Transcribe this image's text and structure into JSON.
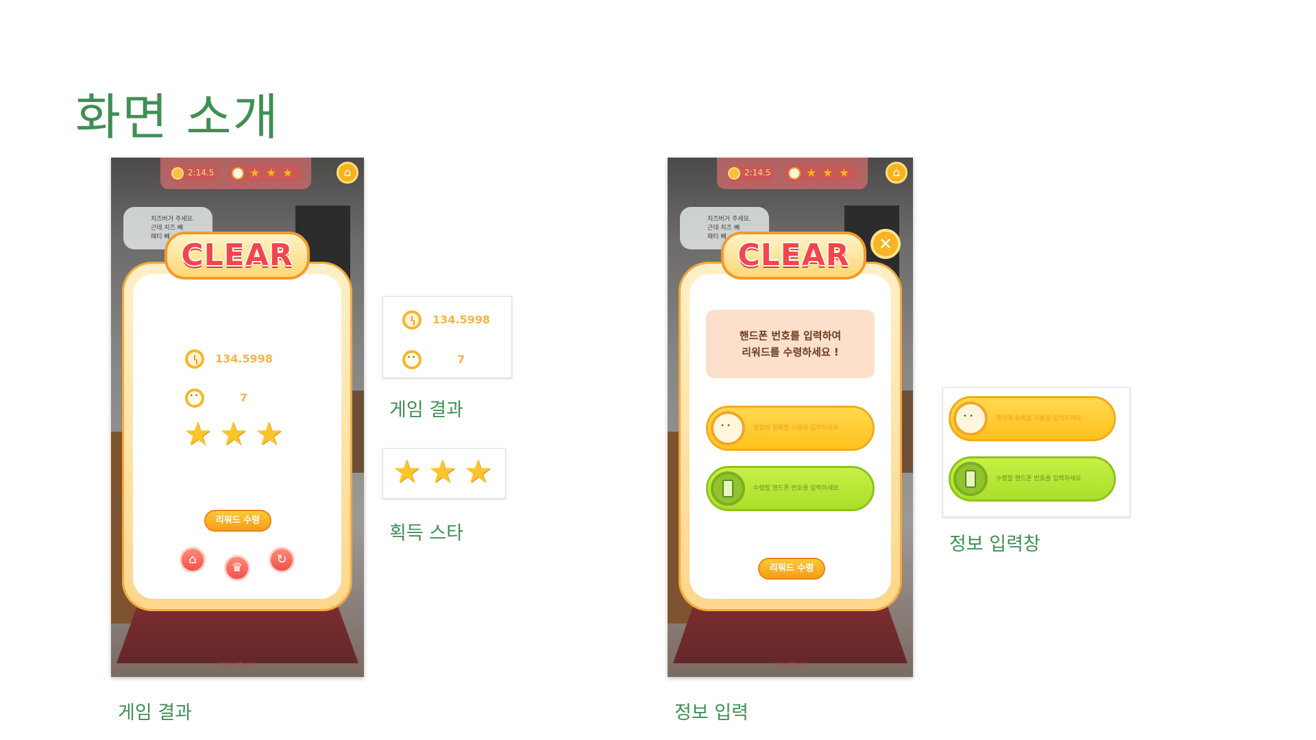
{
  "page": {
    "title": "화면 소개",
    "accent_color": "#3f8f54"
  },
  "captions": {
    "left_phone": "게임 결과",
    "right_phone": "정보 입력",
    "result_thumb": "게임 결과",
    "stars_thumb": "획득 스타",
    "input_thumb": "정보 입력창"
  },
  "hud": {
    "time": "2:14.5",
    "stars": 3,
    "icons": [
      "clock-icon",
      "character-face-icon",
      "star-icon",
      "home-icon"
    ]
  },
  "scene": {
    "sign_lines": [
      "치즈버거 주세요.",
      "근데 치즈 빼",
      "패티 빼"
    ]
  },
  "result_screen": {
    "banner": "CLEAR",
    "time_value": "134.5998",
    "star_count": "7",
    "stars_earned": 3,
    "reward_button": "리워드 수령",
    "bottom_buttons": [
      "home-icon",
      "trophy-icon",
      "replay-icon"
    ],
    "footer_text": "다음 게임 실!"
  },
  "input_screen": {
    "banner": "CLEAR",
    "notice_line1": "핸드폰 번호를 입력하여",
    "notice_line2": "리워드를 수령하세요 !",
    "name_placeholder": "랭킹에 등록할 이름을 입력하세요",
    "phone_placeholder": "수령할 핸드폰 번호를 입력하세요",
    "reward_button": "리워드 수령",
    "footer_text": "다음 게임 실!"
  },
  "thumbnails": {
    "result": {
      "time_value": "134.5998",
      "star_count": "7"
    },
    "stars": {
      "count": 3
    },
    "input": {
      "name_placeholder": "랭킹에 등록할 이름을 입력하세요",
      "phone_placeholder": "수령할 핸드폰 번호를 입력하세요"
    }
  }
}
